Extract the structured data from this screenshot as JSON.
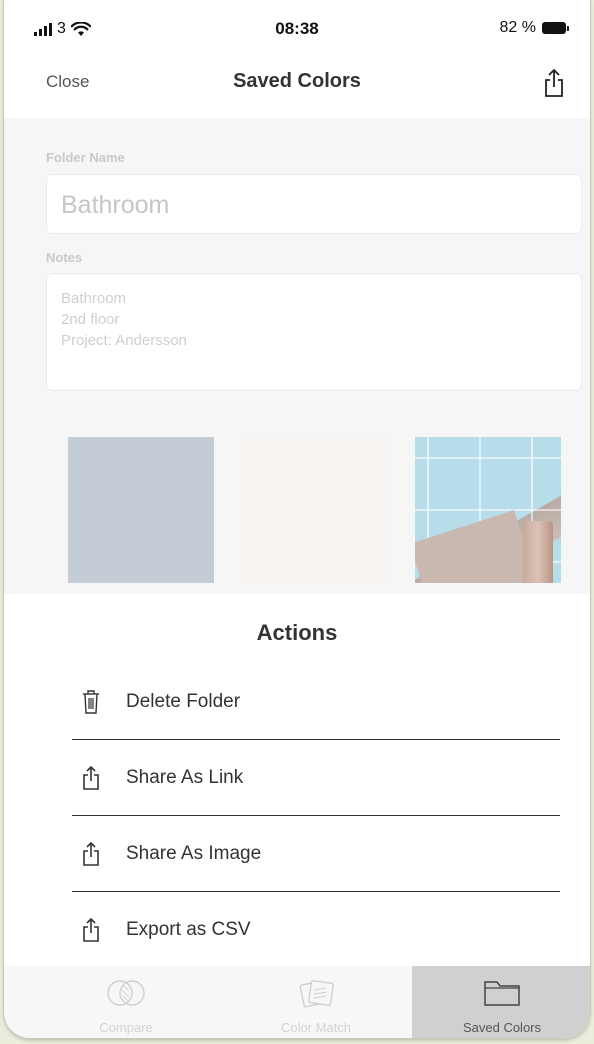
{
  "status_bar": {
    "carrier": "3",
    "time": "08:38",
    "battery": "82 %"
  },
  "nav": {
    "close_label": "Close",
    "title": "Saved Colors",
    "share_icon": "share-icon"
  },
  "form": {
    "folder_name_label": "Folder Name",
    "folder_name_value": "Bathroom",
    "notes_label": "Notes",
    "notes_value": "Bathroom\n2nd floor\nProject: Andersson"
  },
  "swatches": [
    {
      "color": "#c4ccd5"
    },
    {
      "color": "#f7f4f1"
    },
    {
      "type": "image",
      "icon": "bathroom-tile-photo"
    }
  ],
  "actions_sheet": {
    "title": "Actions",
    "items": [
      {
        "label": "Delete Folder",
        "icon": "trash-icon"
      },
      {
        "label": "Share As Link",
        "icon": "share-icon"
      },
      {
        "label": "Share As Image",
        "icon": "share-icon"
      },
      {
        "label": "Export as CSV",
        "icon": "share-icon"
      }
    ]
  },
  "tab_bar": {
    "tabs": [
      {
        "label": "Compare",
        "icon": "compare-icon",
        "active": false
      },
      {
        "label": "Color Match",
        "icon": "color-match-icon",
        "active": false
      },
      {
        "label": "Saved Colors",
        "icon": "folder-icon",
        "active": true
      }
    ]
  }
}
